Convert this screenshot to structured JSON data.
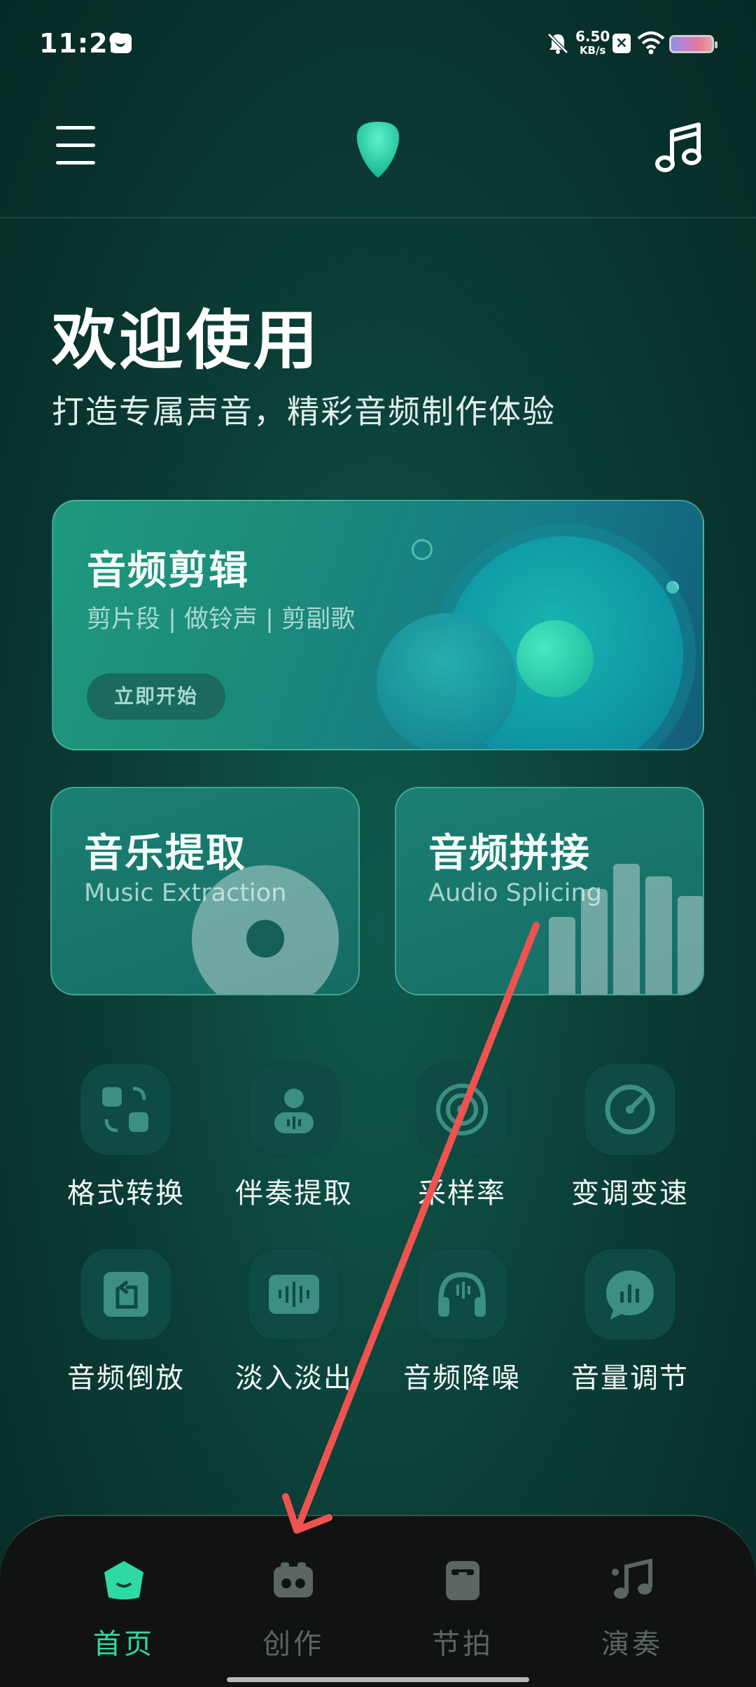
{
  "status_bar": {
    "time": "11:29",
    "net_speed_value": "6.50",
    "net_speed_unit": "KB/s"
  },
  "header": {
    "welcome": "欢迎使用",
    "subtitle": "打造专属声音，精彩音频制作体验"
  },
  "feature_main": {
    "title": "音频剪辑",
    "subtitle": "剪片段 | 做铃声 | 剪副歌",
    "button": "立即开始"
  },
  "feature_left": {
    "title": "音乐提取",
    "subtitle": "Music Extraction"
  },
  "feature_right": {
    "title": "音频拼接",
    "subtitle": "Audio Splicing"
  },
  "tools": [
    {
      "label": "格式转换",
      "icon": "format-convert-icon"
    },
    {
      "label": "伴奏提取",
      "icon": "accompaniment-icon"
    },
    {
      "label": "采样率",
      "icon": "sample-rate-icon"
    },
    {
      "label": "变调变速",
      "icon": "pitch-speed-icon"
    },
    {
      "label": "音频倒放",
      "icon": "reverse-icon"
    },
    {
      "label": "淡入淡出",
      "icon": "fade-icon"
    },
    {
      "label": "音频降噪",
      "icon": "denoise-icon"
    },
    {
      "label": "音量调节",
      "icon": "volume-icon"
    }
  ],
  "tabs": [
    {
      "label": "首页",
      "active": true
    },
    {
      "label": "创作",
      "active": false
    },
    {
      "label": "节拍",
      "active": false
    },
    {
      "label": "演奏",
      "active": false
    }
  ],
  "colors": {
    "accent": "#2fd9a3",
    "background": "#0b3f37",
    "tabbar": "#111313",
    "annotation_arrow": "#ef5350"
  }
}
